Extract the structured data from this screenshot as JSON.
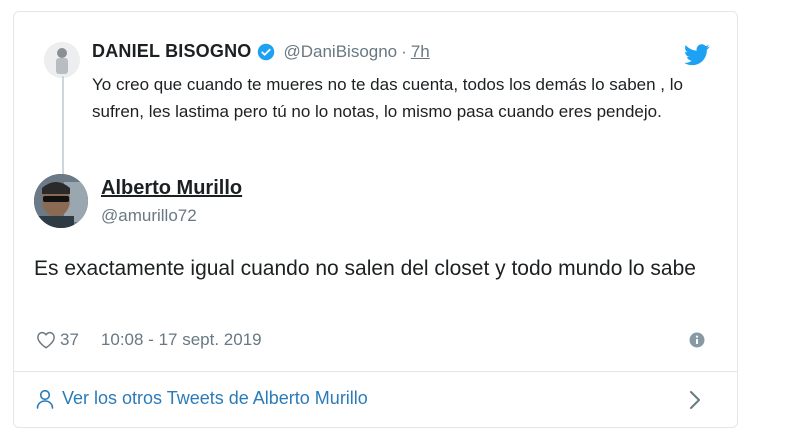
{
  "parent_tweet": {
    "name": "DANIEL BISOGNO",
    "handle": "@DaniBisogno",
    "separator": "·",
    "time": "7h",
    "text": "Yo creo  que cuando te mueres no te das cuenta, todos los demás lo saben , lo sufren, les lastima pero tú no lo notas, lo mismo pasa cuando eres pendejo."
  },
  "tweet": {
    "name": "Alberto Murillo",
    "handle": "@amurillo72",
    "text": "Es exactamente igual cuando no salen del closet y todo mundo lo sabe",
    "likes": "37",
    "timestamp": "10:08 - 17 sept. 2019"
  },
  "footer": {
    "more_link": "Ver los otros Tweets de Alberto Murillo"
  },
  "colors": {
    "twitter_blue": "#1da1f2",
    "link_blue": "#2b7bb9",
    "muted": "#697882",
    "border": "#e1e8ed"
  },
  "icons": [
    "verified-badge-icon",
    "twitter-bird-icon",
    "heart-icon",
    "info-icon",
    "person-icon",
    "chevron-right-icon"
  ]
}
